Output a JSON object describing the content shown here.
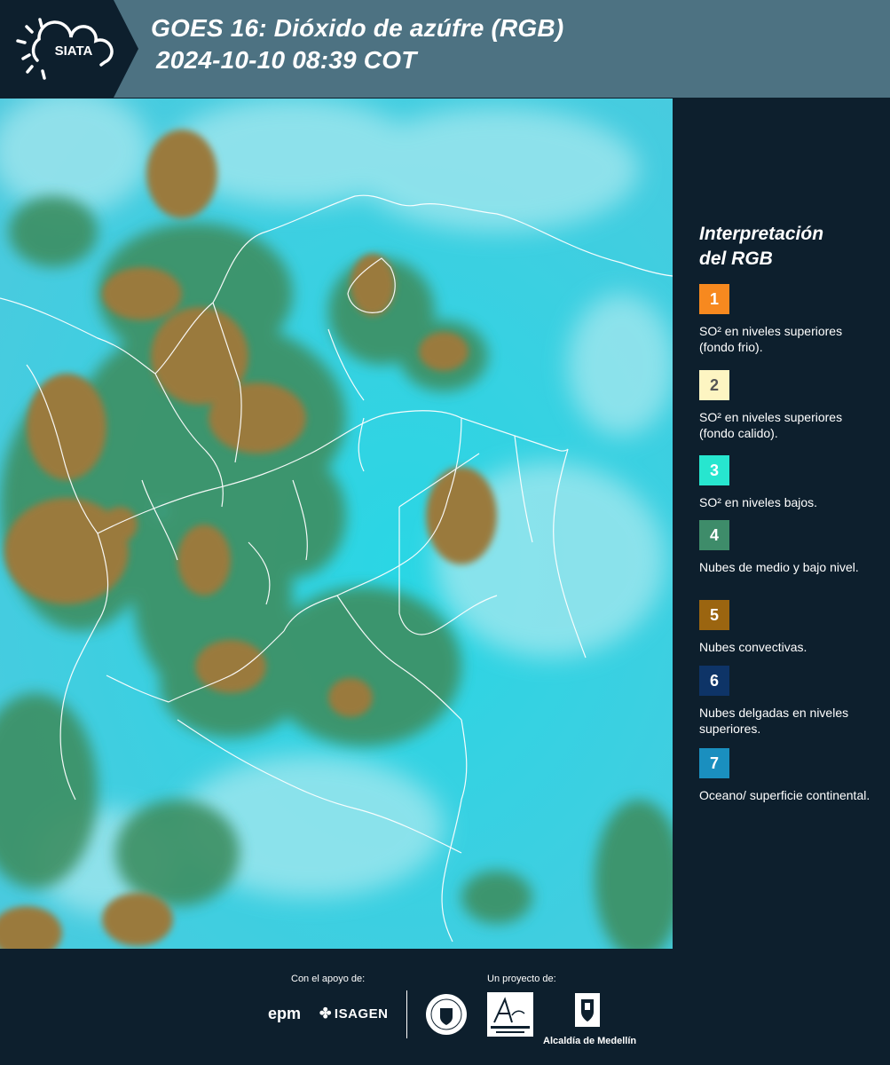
{
  "header": {
    "logo_text": "SIATA",
    "title_line1": "GOES 16: Dióxido de azúfre (RGB)",
    "title_line2": "2024-10-10 08:39 COT"
  },
  "legend": {
    "title_line1": "Interpretación",
    "title_line2": "del RGB",
    "items": [
      {
        "number": "1",
        "color": "#f7891f",
        "description": "SO² en niveles superiores (fondo frio)."
      },
      {
        "number": "2",
        "color": "#fdf5c2",
        "description": "SO² en niveles superiores (fondo calido)."
      },
      {
        "number": "3",
        "color": "#27e6cf",
        "description": "SO² en niveles bajos."
      },
      {
        "number": "4",
        "color": "#3e8c6a",
        "description": "Nubes de medio y bajo nivel."
      },
      {
        "number": "5",
        "color": "#9b6510",
        "description": "Nubes convectivas."
      },
      {
        "number": "6",
        "color": "#0e3467",
        "description": "Nubes delgadas en niveles superiores."
      },
      {
        "number": "7",
        "color": "#1a8fbf",
        "description": "Oceano/ superficie continental."
      }
    ]
  },
  "footer": {
    "support_label": "Con el apoyo de:",
    "project_label": "Un proyecto de:",
    "epm": "epm",
    "isagen": "ISAGEN",
    "alcaldia": "Alcaldía de Medellín"
  }
}
